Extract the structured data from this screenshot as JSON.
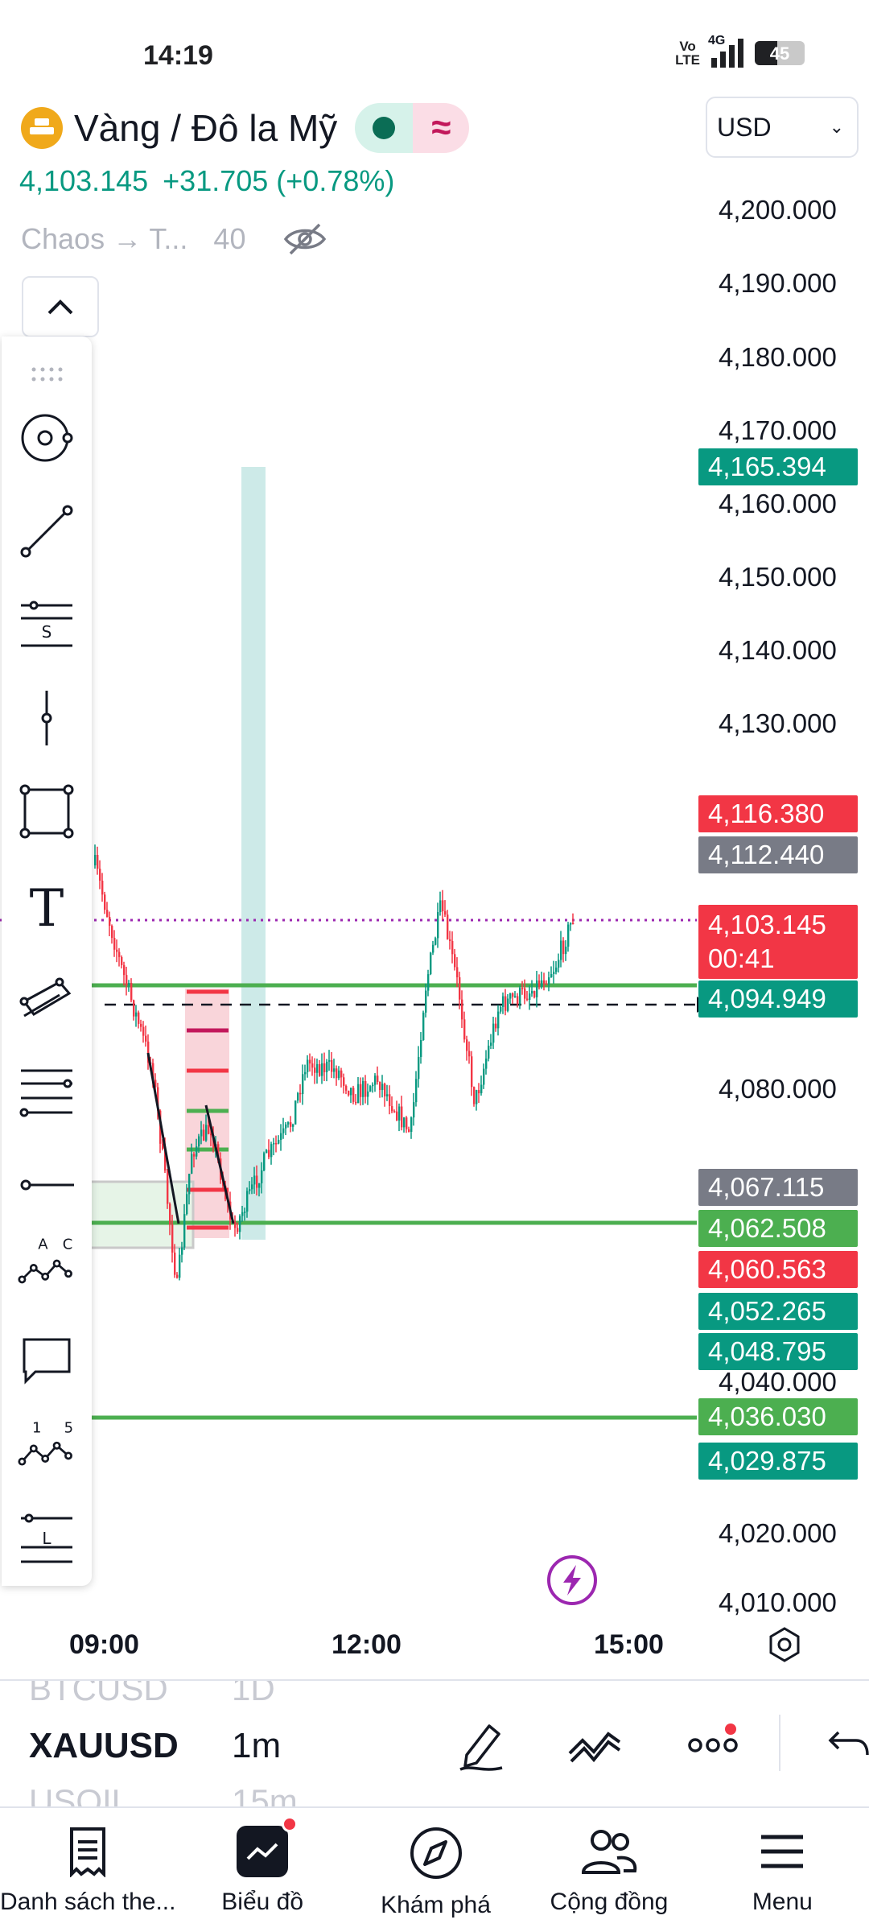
{
  "status_bar": {
    "time": "14:19",
    "volte": "Vo\nLTE",
    "network": "4G",
    "battery": "45"
  },
  "header": {
    "symbol_name": "Vàng / Đô la Mỹ",
    "currency": "USD",
    "price": "4,103.145",
    "change": "+31.705 (+0.78%)",
    "indicator_name": "Chaos → T...",
    "indicator_value": "40"
  },
  "price_axis": {
    "labels": [
      "4,200.000",
      "4,190.000",
      "4,180.000",
      "4,170.000",
      "4,160.000",
      "4,150.000",
      "4,140.000",
      "4,130.000",
      "4,080.000",
      "4,040.000",
      "4,020.000",
      "4,010.000"
    ],
    "tags": [
      {
        "value": "4,165.394",
        "color": "green"
      },
      {
        "value": "4,116.380",
        "color": "red"
      },
      {
        "value": "4,112.440",
        "color": "gray"
      },
      {
        "value": "4,094.949",
        "color": "green"
      },
      {
        "value": "4,067.115",
        "color": "gray"
      },
      {
        "value": "4,062.508",
        "color": "lime"
      },
      {
        "value": "4,060.563",
        "color": "red"
      },
      {
        "value": "4,052.265",
        "color": "green"
      },
      {
        "value": "4,048.795",
        "color": "green"
      },
      {
        "value": "4,036.030",
        "color": "lime"
      },
      {
        "value": "4,029.875",
        "color": "green"
      }
    ],
    "current_price": "4,103.145",
    "countdown": "00:41"
  },
  "time_axis": [
    "09:00",
    "12:00",
    "15:00"
  ],
  "toolbar": {
    "tools": [
      "drag-handle-icon",
      "cursor-icon",
      "trend-line-icon",
      "fib-icon",
      "vertical-line-icon",
      "rectangle-icon",
      "text-icon",
      "channel-icon",
      "horizontal-lines-icon",
      "horizontal-ray-icon",
      "pattern-icon",
      "callout-icon",
      "elliott-wave-icon",
      "long-position-icon"
    ],
    "pattern_labels": [
      "A",
      "C"
    ],
    "wave_labels": [
      "1",
      "5"
    ],
    "fib_label": "S",
    "long_label": "L",
    "text_label": "T"
  },
  "picker": {
    "prev_symbol": "BTCUSD",
    "prev_interval": "1D",
    "symbol": "XAUUSD",
    "interval": "1m",
    "next_symbol": "USOIL",
    "next_interval": "15m"
  },
  "nav": [
    {
      "label": "Danh sách the..."
    },
    {
      "label": "Biểu đồ"
    },
    {
      "label": "Khám phá"
    },
    {
      "label": "Cộng đồng"
    },
    {
      "label": "Menu"
    }
  ],
  "colors": {
    "up": "#089981",
    "down": "#f23645",
    "accent": "#2962ff",
    "level": "#4caf50"
  }
}
